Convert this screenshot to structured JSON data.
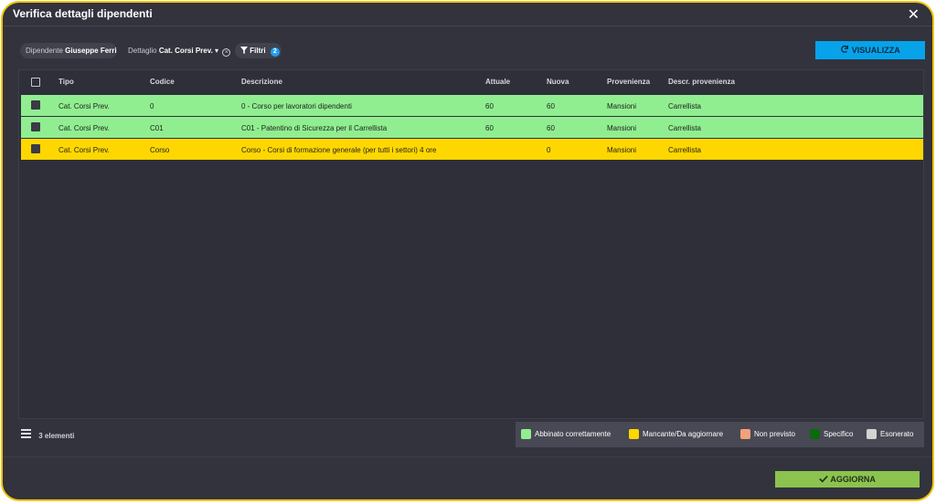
{
  "dialog": {
    "title": "Verifica dettagli dipendenti",
    "close_symbol": "✕"
  },
  "filters": {
    "employee_label": "Dipendente",
    "employee_value": "Giuseppe Ferri",
    "detail_label": "Dettaglio",
    "detail_value": "Cat. Corsi Prev.",
    "filter_label": "Filtri",
    "filter_count": "2"
  },
  "actions": {
    "view_label": "VISUALIZZA",
    "update_label": "AGGIORNA"
  },
  "table": {
    "columns": [
      "Tipo",
      "Codice",
      "Descrizione",
      "Attuale",
      "Nuova",
      "Provenienza",
      "Descr. provenienza"
    ],
    "rows": [
      {
        "tipo": "Cat. Corsi Prev.",
        "codice": "0",
        "descrizione": "0 - Corso per lavoratori dipendenti",
        "attuale": "60",
        "nuova": "60",
        "provenienza": "Mansioni",
        "descr_provenienza": "Carrellista",
        "status_color": "#90ee90"
      },
      {
        "tipo": "Cat. Corsi Prev.",
        "codice": "C01",
        "descrizione": "C01 - Patentino di Sicurezza per il Carrellista",
        "attuale": "60",
        "nuova": "60",
        "provenienza": "Mansioni",
        "descr_provenienza": "Carrellista",
        "status_color": "#90ee90"
      },
      {
        "tipo": "Cat. Corsi Prev.",
        "codice": "Corso",
        "descrizione": "Corso - Corsi di formazione generale (per tutti i settori) 4 ore",
        "attuale": "",
        "nuova": "0",
        "provenienza": "Mansioni",
        "descr_provenienza": "Carrellista",
        "status_color": "#ffd700"
      }
    ]
  },
  "footer": {
    "count_label": "3 elementi"
  },
  "legend": [
    {
      "label": "Abbinato correttamente",
      "color": "#90ee90"
    },
    {
      "label": "Mancante/Da aggiornare",
      "color": "#ffd700"
    },
    {
      "label": "Non previsto",
      "color": "#f4a07a"
    },
    {
      "label": "Specifico",
      "color": "#0b6a0b"
    },
    {
      "label": "Esonerato",
      "color": "#d3d3d3"
    }
  ],
  "icons": {
    "refresh": "refresh-icon",
    "check": "check-icon",
    "filter": "filter-icon",
    "menu": "menu-icon"
  }
}
